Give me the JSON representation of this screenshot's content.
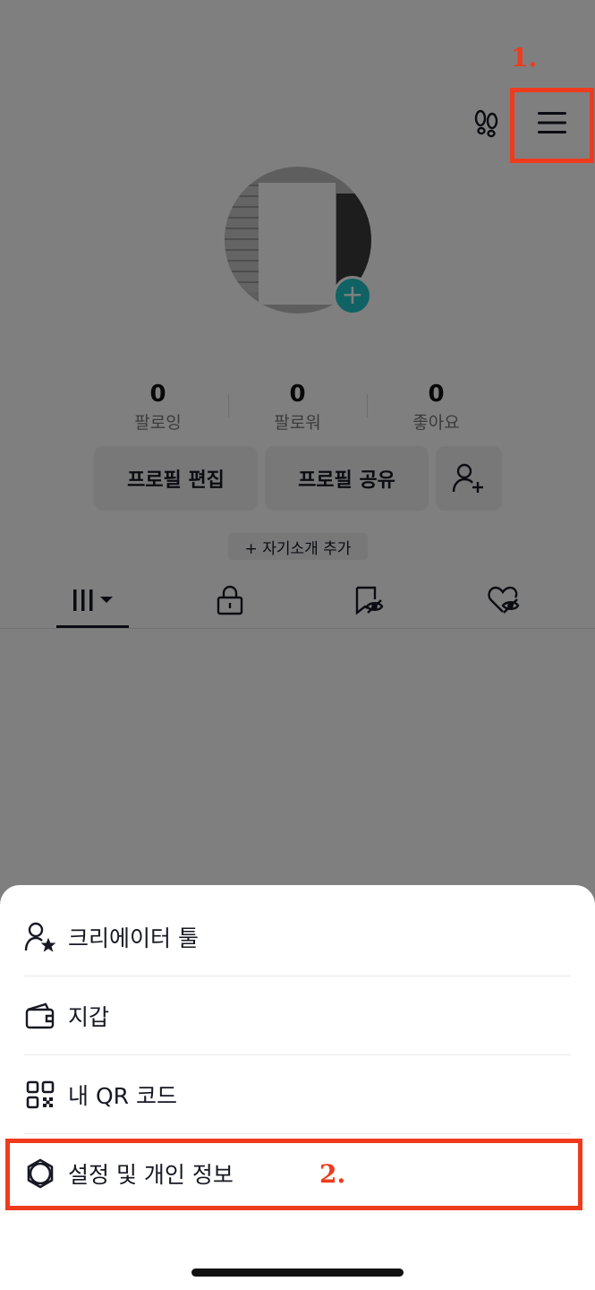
{
  "stats": [
    {
      "value": "0",
      "label": "팔로잉"
    },
    {
      "value": "0",
      "label": "팔로워"
    },
    {
      "value": "0",
      "label": "좋아요"
    }
  ],
  "buttons": {
    "edit_profile": "프로필 편집",
    "share_profile": "프로필 공유"
  },
  "bio_chip": "+ 자기소개 추가",
  "sheet": {
    "items": [
      {
        "label": "크리에이터 툴",
        "icon": "person-star-icon"
      },
      {
        "label": "지갑",
        "icon": "wallet-icon"
      },
      {
        "label": "내 QR 코드",
        "icon": "qr-code-icon"
      },
      {
        "label": "설정 및 개인 정보",
        "icon": "gear-icon"
      }
    ]
  },
  "annotations": {
    "step1": "1.",
    "step2": "2."
  },
  "colors": {
    "annotation": "#ef3b1d",
    "avatar_add": "#20c5c8"
  }
}
